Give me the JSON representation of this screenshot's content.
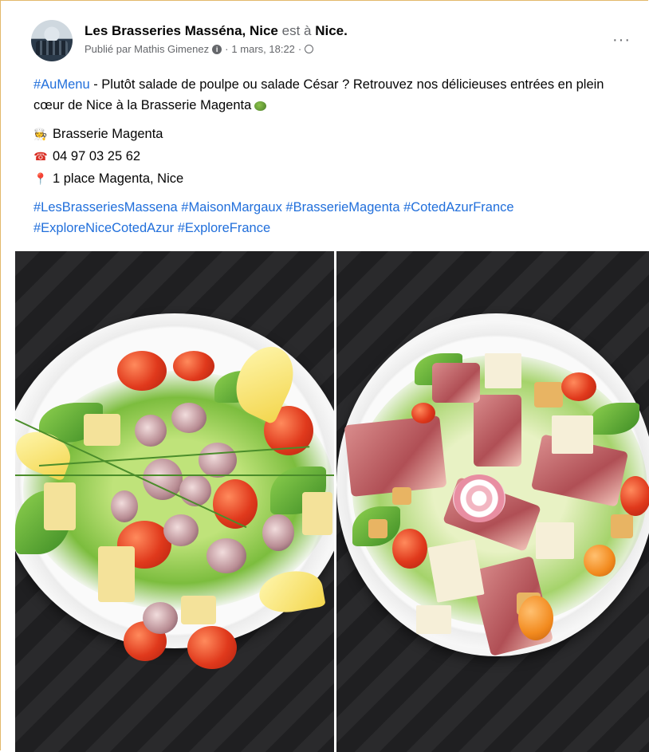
{
  "post": {
    "author": "Les Brasseries Masséna, Nice",
    "location_prefix": "est à",
    "location": "Nice.",
    "published_by": "Publié par Mathis Gimenez",
    "separator": "·",
    "date": "1 mars, 18:22",
    "more_label": "···",
    "hashtag_menu": "#AuMenu",
    "text_line": " - Plutôt salade de poulpe ou salade César ? Retrouvez nos délicieuses entrées en plein cœur de Nice à la Brasserie Magenta",
    "restaurant_emoji": "🧑‍🍳",
    "restaurant": "Brasserie Magenta",
    "phone_emoji": "☎",
    "phone": "04 97 03 25 62",
    "address_emoji": "📍",
    "address": "1 place Magenta, Nice",
    "hashtags": [
      "#LesBrasseriesMassena",
      "#MaisonMargaux",
      "#BrasserieMagenta",
      "#CotedAzurFrance",
      "#ExploreNiceCotedAzur",
      "#ExploreFrance"
    ]
  },
  "icons": {
    "avatar": "restaurant-team-photo",
    "info_badge": "i",
    "globe": "globe-icon",
    "salad": "green-salad-emoji"
  },
  "colors": {
    "hashtag": "#216fdb",
    "meta_text": "#65676b",
    "border": "#e2b96a"
  }
}
